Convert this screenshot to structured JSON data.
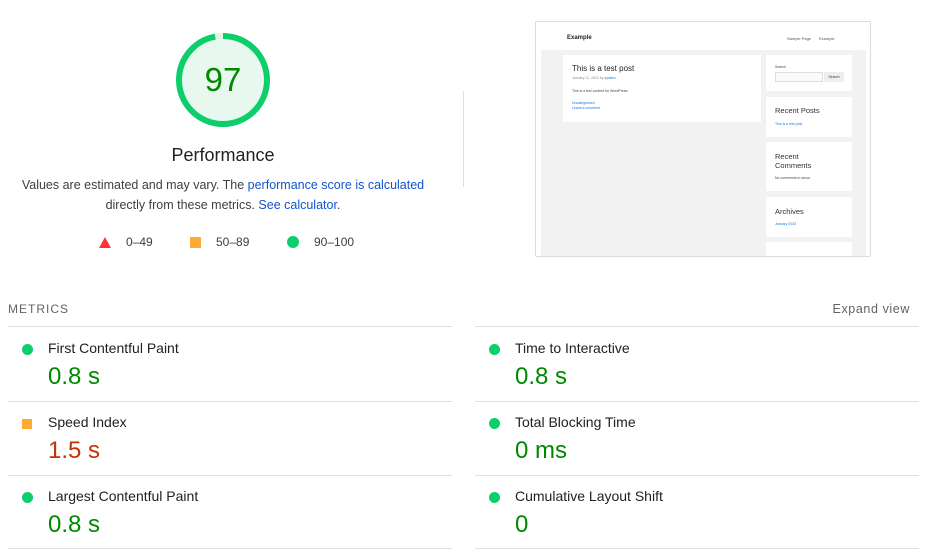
{
  "performance": {
    "score": "97",
    "score_value": 97,
    "title": "Performance",
    "note_prefix": "Values are estimated and may vary. The ",
    "note_link1": "performance score is calculated",
    "note_mid": "directly from these metrics. ",
    "note_link2": "See calculator",
    "note_suffix": ".",
    "colors": {
      "pass": "#0cce6b",
      "average": "#ffaa33",
      "fail": "#ff3333",
      "pass_text": "#008800",
      "average_text": "#c33300"
    }
  },
  "legend": [
    {
      "icon": "red-triangle-icon",
      "label": "0–49"
    },
    {
      "icon": "orange-square-icon",
      "label": "50–89"
    },
    {
      "icon": "green-circle-icon",
      "label": "90–100"
    }
  ],
  "thumbnail": {
    "site_title": "Example",
    "nav": [
      "Sample Page",
      "Example"
    ],
    "post_title": "This is a test post",
    "post_meta": "January 11, 2022 by ",
    "post_author": "system",
    "post_text": "This is a test content for WordPress.",
    "post_category": "Uncategorized",
    "post_comment": "Leave a comment",
    "search_label": "Search",
    "search_button": "Search",
    "recent_posts_title": "Recent Posts",
    "recent_posts_item": "This is a test post",
    "recent_comments_title": "Recent Comments",
    "recent_comments_text": "No comments to show.",
    "archives_title": "Archives",
    "archives_item": "January 2022"
  },
  "metrics": {
    "heading": "METRICS",
    "expand_label": "Expand view",
    "items": [
      {
        "name": "First Contentful Paint",
        "value": "0.8 s",
        "rating": "pass"
      },
      {
        "name": "Time to Interactive",
        "value": "0.8 s",
        "rating": "pass"
      },
      {
        "name": "Speed Index",
        "value": "1.5 s",
        "rating": "average"
      },
      {
        "name": "Total Blocking Time",
        "value": "0 ms",
        "rating": "pass"
      },
      {
        "name": "Largest Contentful Paint",
        "value": "0.8 s",
        "rating": "pass"
      },
      {
        "name": "Cumulative Layout Shift",
        "value": "0",
        "rating": "pass"
      }
    ]
  }
}
